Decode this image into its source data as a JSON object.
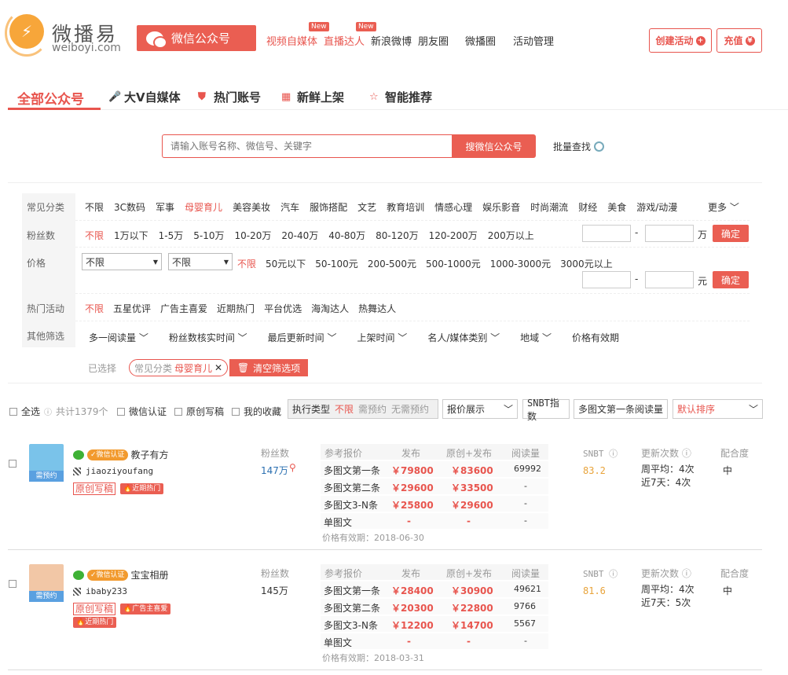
{
  "header": {
    "logo_cn": "微播易",
    "logo_en": "weiboyi.com",
    "channel_button": "微信公众号",
    "nav": [
      {
        "label": "视频自媒体",
        "badge": "New",
        "active": true
      },
      {
        "label": "直播达人",
        "badge": "New",
        "active": true
      },
      {
        "label": "新浪微博"
      },
      {
        "label": "朋友圈"
      },
      {
        "label": "微播圈"
      },
      {
        "label": "活动管理"
      }
    ],
    "create_button": "创建活动",
    "recharge_button": "充值"
  },
  "tabs": [
    "全部公众号",
    "大V自媒体",
    "热门账号",
    "新鲜上架",
    "智能推荐"
  ],
  "search": {
    "placeholder": "请输入账号名称、微信号、关键字",
    "button": "搜微信公众号",
    "batch": "批量查找"
  },
  "filters": {
    "category_label": "常见分类",
    "categories": [
      "不限",
      "3C数码",
      "军事",
      "母婴育儿",
      "美容美妆",
      "汽车",
      "服饰搭配",
      "文艺",
      "教育培训",
      "情感心理",
      "娱乐影音",
      "时尚潮流",
      "财经",
      "美食",
      "游戏/动漫"
    ],
    "category_active": 3,
    "more": "更多",
    "fans_label": "粉丝数",
    "fans": [
      "不限",
      "1万以下",
      "1-5万",
      "5-10万",
      "10-20万",
      "20-40万",
      "40-80万",
      "80-120万",
      "120-200万",
      "200万以上"
    ],
    "fans_unit": "万",
    "confirm": "确定",
    "price_label": "价格",
    "price_select1": "不限",
    "price_select2": "不限",
    "prices": [
      "不限",
      "50元以下",
      "50-100元",
      "200-500元",
      "500-1000元",
      "1000-3000元",
      "3000元以上"
    ],
    "price_unit": "元",
    "range_sep": "-",
    "hot_label": "热门活动",
    "hot": [
      "不限",
      "五星优评",
      "广告主喜爱",
      "近期热门",
      "平台优选",
      "海淘达人",
      "热舞达人"
    ],
    "other_label": "其他筛选",
    "other": [
      "多一阅读量",
      "粉丝数核实时间",
      "最后更新时间",
      "上架时间",
      "名人/媒体类别",
      "地域",
      "价格有效期"
    ],
    "selected_label": "已选择",
    "selected_chip_key": "常见分类",
    "selected_chip_value": "母婴育儿",
    "clear": "清空筛选项"
  },
  "toolbar": {
    "select_all": "全选",
    "total": "共计1379个",
    "wechat_verified": "微信认证",
    "original": "原创写稿",
    "favorites": "我的收藏",
    "exec_type": "执行类型",
    "exec_options": [
      "不限",
      "需预约",
      "无需预约"
    ],
    "quote_display": "报价展示",
    "snbt_index": "SNBT指数",
    "first_read": "多图文第一条阅读量",
    "sort": "默认排序"
  },
  "table_headers": {
    "fans": "粉丝数",
    "ref_price": "参考报价",
    "publish": "发布",
    "orig_publish": "原创+发布",
    "reads": "阅读量",
    "snbt": "SNBT",
    "update_count": "更新次数",
    "fit": "配合度"
  },
  "accounts": [
    {
      "name": "教子有方",
      "verified": "微信认证",
      "wechat_id": "jiaoziyoufang",
      "avatar_tag": "需预约",
      "tags": [
        "原创写稿",
        "近期热门"
      ],
      "fans": "147万",
      "rows": [
        {
          "label": "多图文第一条",
          "publish": "￥79800",
          "orig": "￥83600",
          "reads": "69992"
        },
        {
          "label": "多图文第二条",
          "publish": "￥29600",
          "orig": "￥33500",
          "reads": "-"
        },
        {
          "label": "多图文3-N条",
          "publish": "￥25800",
          "orig": "￥29600",
          "reads": "-"
        },
        {
          "label": "单图文",
          "publish": "-",
          "orig": "-",
          "reads": "-"
        }
      ],
      "validity": "价格有效期：2018-06-30",
      "snbt": "83.2",
      "weekly": "周平均：4次",
      "recent": "近7天：4次",
      "fit": "中"
    },
    {
      "name": "宝宝相册",
      "verified": "微信认证",
      "wechat_id": "ibaby233",
      "avatar_tag": "需预约",
      "tags": [
        "原创写稿",
        "广告主喜爱",
        "近期热门"
      ],
      "fans": "145万",
      "rows": [
        {
          "label": "多图文第一条",
          "publish": "￥28400",
          "orig": "￥30900",
          "reads": "49621"
        },
        {
          "label": "多图文第二条",
          "publish": "￥20300",
          "orig": "￥22800",
          "reads": "9766"
        },
        {
          "label": "多图文3-N条",
          "publish": "￥12200",
          "orig": "￥14700",
          "reads": "5567"
        },
        {
          "label": "单图文",
          "publish": "-",
          "orig": "-",
          "reads": "-"
        }
      ],
      "validity": "价格有效期：2018-03-31",
      "snbt": "81.6",
      "weekly": "周平均：4次",
      "recent": "近7天：5次",
      "fit": "中"
    }
  ],
  "colors": {
    "accent": "#ea5e52",
    "snbt": "#e8a33a",
    "wechat": "#3eb135"
  }
}
